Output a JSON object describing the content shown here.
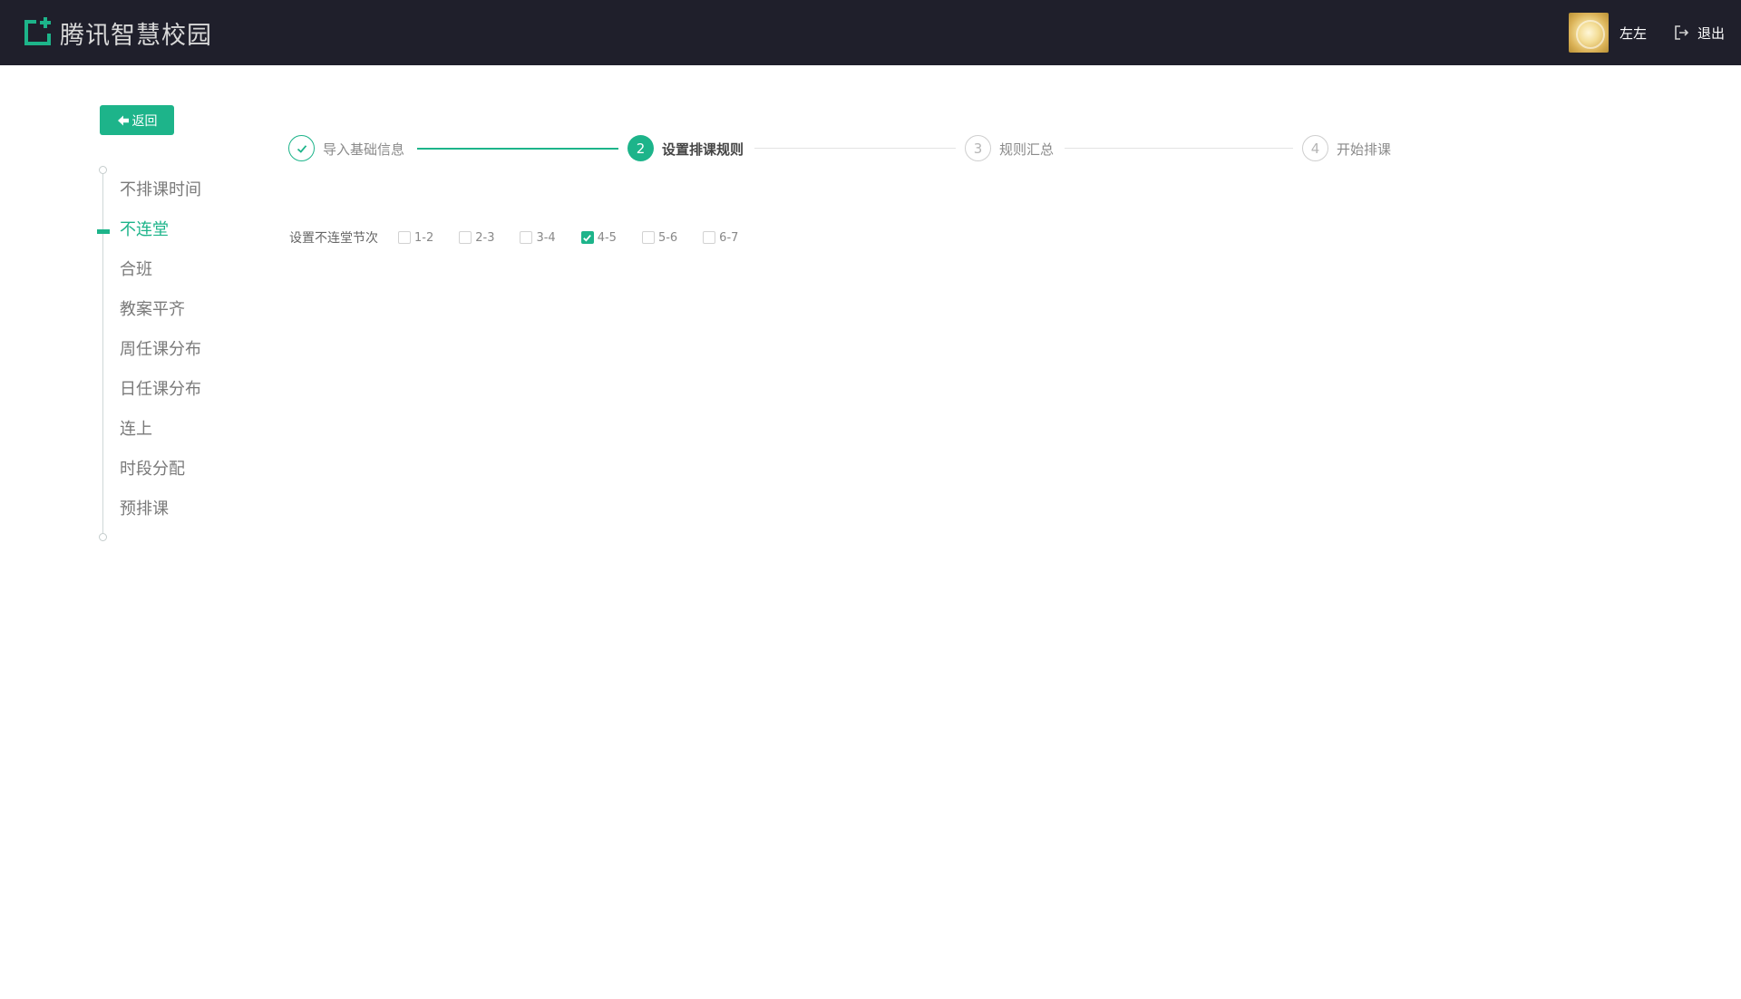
{
  "header": {
    "brand_name": "腾讯智慧校园",
    "username": "左左",
    "logout_label": "退出"
  },
  "back_button": {
    "label": "返回"
  },
  "sidebar": {
    "items": [
      {
        "label": "不排课时间",
        "active": false
      },
      {
        "label": "不连堂",
        "active": true
      },
      {
        "label": "合班",
        "active": false
      },
      {
        "label": "教案平齐",
        "active": false
      },
      {
        "label": "周任课分布",
        "active": false
      },
      {
        "label": "日任课分布",
        "active": false
      },
      {
        "label": "连上",
        "active": false
      },
      {
        "label": "时段分配",
        "active": false
      },
      {
        "label": "预排课",
        "active": false
      }
    ]
  },
  "steps": [
    {
      "number": "1",
      "label": "导入基础信息",
      "status": "done"
    },
    {
      "number": "2",
      "label": "设置排课规则",
      "status": "current"
    },
    {
      "number": "3",
      "label": "规则汇总",
      "status": "pending"
    },
    {
      "number": "4",
      "label": "开始排课",
      "status": "pending"
    }
  ],
  "rule": {
    "label": "设置不连堂节次",
    "options": [
      {
        "label": "1-2",
        "checked": false
      },
      {
        "label": "2-3",
        "checked": false
      },
      {
        "label": "3-4",
        "checked": false
      },
      {
        "label": "4-5",
        "checked": true
      },
      {
        "label": "5-6",
        "checked": false
      },
      {
        "label": "6-7",
        "checked": false
      }
    ]
  },
  "colors": {
    "accent": "#1db48a",
    "header_bg": "#1f1f2b"
  }
}
